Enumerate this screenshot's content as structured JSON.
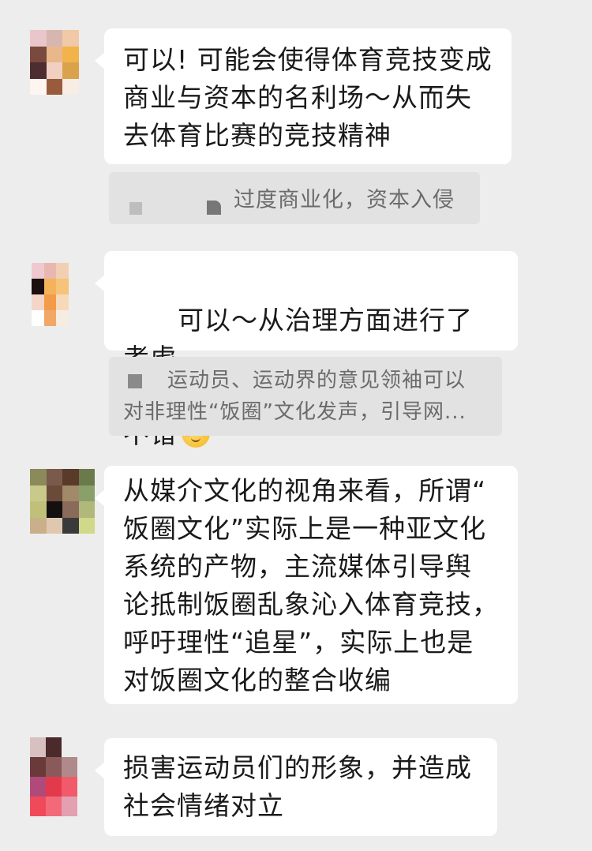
{
  "messages": [
    {
      "text": "可以! 可能会使得体育竞技变成\n商业与资本的名利场～从而失\n去体育比赛的竞技精神",
      "quote": "过度商业化，资本入侵"
    },
    {
      "text_line1": "可以～从治理方面进行了考虑，",
      "text_line2": "不错",
      "emoji": "relieved-face",
      "quote_line1": "运动员、运动界的意见领袖可以",
      "quote_line2": "对非理性“饭圈”文化发声，引导网..."
    },
    {
      "text": "从媒介文化的视角来看，所谓“\n饭圈文化”实际上是一种亚文化\n系统的产物，主流媒体引导舆\n论抵制饭圈乱象沁入体育竞技，\n呼吁理性“追星”，实际上也是\n对饭圈文化的整合收编"
    },
    {
      "text": "损害运动员们的形象，并造成\n社会情绪对立"
    }
  ],
  "colors": {
    "background": "#ededed",
    "bubble": "#ffffff",
    "quote_background": "#e2e2e2",
    "quote_text": "#6b6b6b",
    "text": "#1a1a1a"
  }
}
